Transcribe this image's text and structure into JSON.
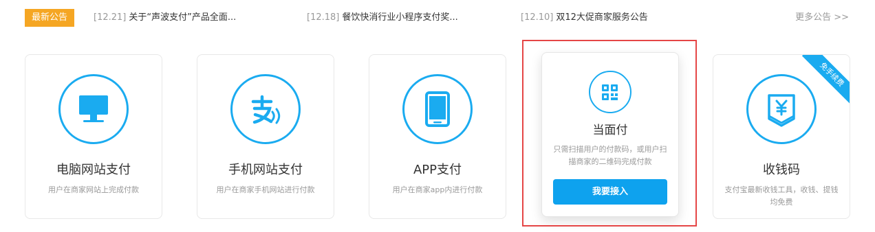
{
  "notices": {
    "badge": "最新公告",
    "items": [
      {
        "date": "[12.21]",
        "text": "关于“声波支付”产品全面..."
      },
      {
        "date": "[12.18]",
        "text": "餐饮快消行业小程序支付奖..."
      },
      {
        "date": "[12.10]",
        "text": "双12大促商家服务公告"
      }
    ],
    "more": "更多公告 >>"
  },
  "products": [
    {
      "title": "电脑网站支付",
      "desc": "用户在商家网站上完成付款",
      "icon": "monitor-icon"
    },
    {
      "title": "手机网站支付",
      "desc": "用户在商家手机网站进行付款",
      "icon": "alipay-wave-icon"
    },
    {
      "title": "APP支付",
      "desc": "用户在商家app内进行付款",
      "icon": "phone-icon"
    },
    {
      "title": "当面付",
      "desc": "只需扫描用户的付款码，或用户扫描商家的二维码完成付款",
      "icon": "qrcode-icon",
      "button": "我要接入"
    },
    {
      "title": "收钱码",
      "desc": "支付宝最新收钱工具，收钱、提钱均免费",
      "icon": "yuan-code-icon",
      "ribbon": "免手续费"
    }
  ],
  "colors": {
    "accent": "#1aabf0",
    "badge": "#f5a623",
    "button": "#0ea2ee",
    "highlight": "#e54545"
  }
}
